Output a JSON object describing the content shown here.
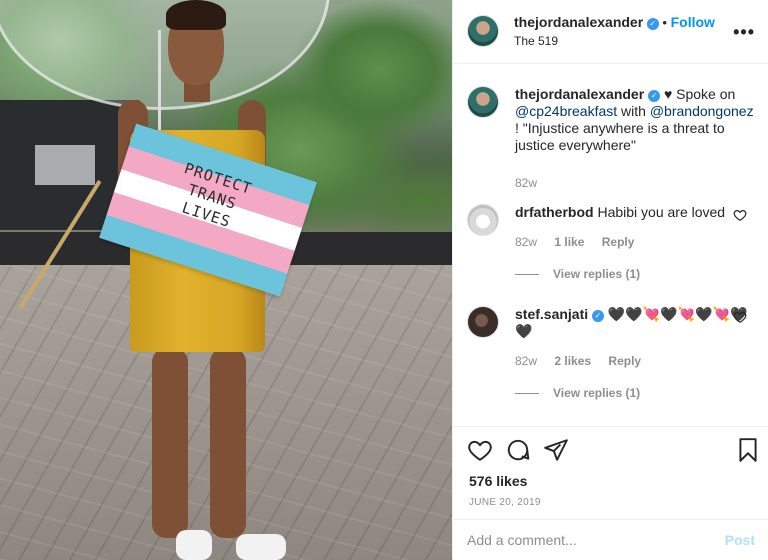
{
  "photo": {
    "flag_text_1": "PROTECT",
    "flag_text_2": "TRANS",
    "flag_text_3": "LIVES"
  },
  "header": {
    "username": "thejordanalexander",
    "separator": "•",
    "follow_label": "Follow",
    "location": "The 519",
    "more_label": "•••"
  },
  "caption": {
    "username": "thejordanalexander",
    "heart": "♥",
    "text_1": " Spoke on ",
    "mention_1": "@cp24breakfast",
    "text_2": " with ",
    "mention_2": "@brandongonez",
    "text_3": " ! \"Injustice anywhere is a threat to justice everywhere\"",
    "time": "82w"
  },
  "comments": [
    {
      "username": "drfatherbod",
      "text": "Habibi you are loved",
      "time": "82w",
      "likes": "1 like",
      "reply_label": "Reply",
      "view_replies": "View replies (1)"
    },
    {
      "username": "stef.sanjati",
      "text": "🖤🖤💘🖤💘🖤💘🖤 🖤",
      "time": "82w",
      "likes": "2 likes",
      "reply_label": "Reply",
      "view_replies": "View replies (1)"
    }
  ],
  "actions": {
    "likes": "576 likes",
    "date": "JUNE 20, 2019",
    "add_comment_placeholder": "Add a comment...",
    "post_label": "Post"
  },
  "colors": {
    "link_blue": "#0095f6",
    "verified_blue": "#3897f0",
    "post_disabled": "#b2dffc",
    "muted_text": "#8e8e8e"
  }
}
